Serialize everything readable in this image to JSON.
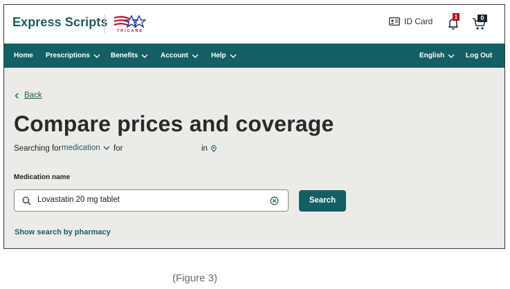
{
  "brand": {
    "name": "Express Scripts",
    "partner_logo_text": "TRICARE",
    "partner_logo_icon": "tricare-flag-eagle-logo"
  },
  "header": {
    "id_card_label": "ID Card",
    "notifications_count": "1",
    "cart_count": "0"
  },
  "nav": {
    "home": "Home",
    "prescriptions": "Prescriptions",
    "benefits": "Benefits",
    "account": "Account",
    "help": "Help",
    "language": "English",
    "logout": "Log Out"
  },
  "page": {
    "back_label": "Back",
    "title": "Compare prices and coverage",
    "searching_for": "Searching for",
    "search_type": "medication",
    "for_label": "for",
    "in_label": "in"
  },
  "search": {
    "label": "Medication name",
    "value": "Lovastatin 20 mg tablet",
    "button_label": "Search",
    "alt_link": "Show search by pharmacy"
  },
  "caption": "(Figure 3)",
  "colors": {
    "brand_teal": "#145f64",
    "text_teal": "#1b5c62",
    "alert_red": "#b5121b",
    "page_bg": "#ecebe7"
  }
}
